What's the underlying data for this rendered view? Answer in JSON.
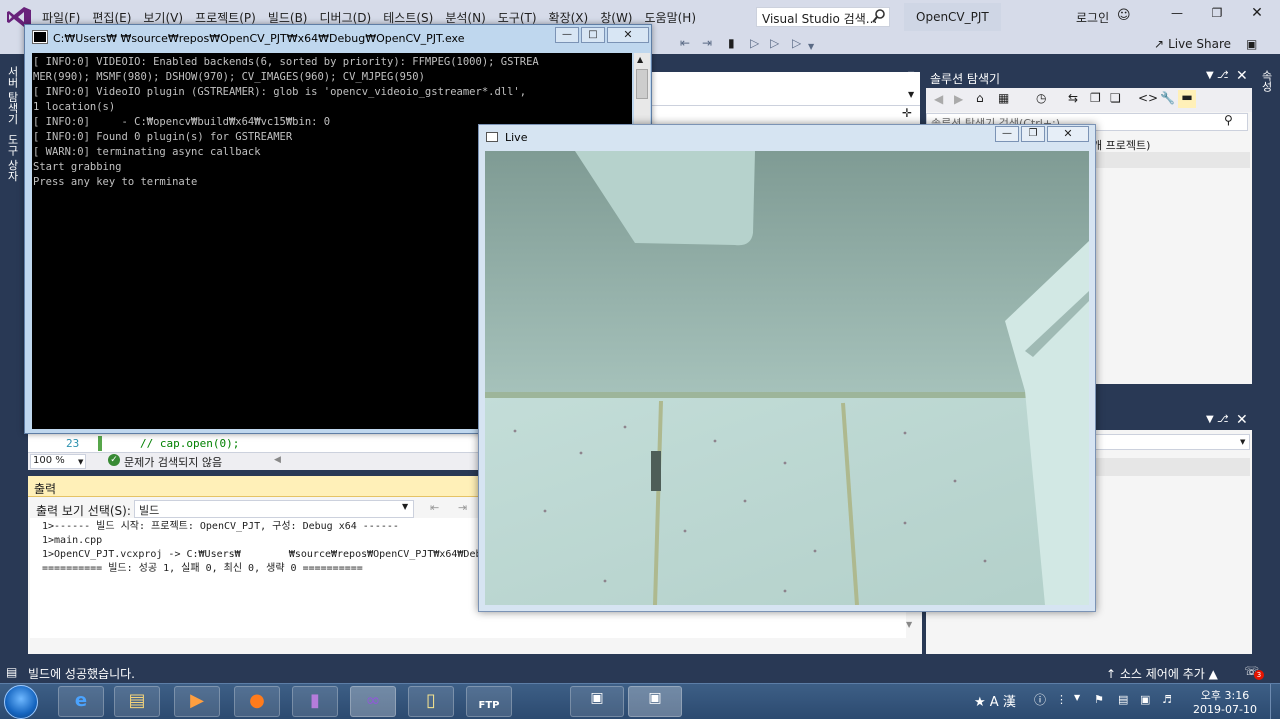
{
  "vs": {
    "menu": [
      "파일(F)",
      "편집(E)",
      "보기(V)",
      "프로젝트(P)",
      "빌드(B)",
      "디버그(D)",
      "테스트(S)",
      "분석(N)",
      "도구(T)",
      "확장(X)",
      "창(W)",
      "도움말(H)"
    ],
    "search_placeholder": "Visual Studio 검색...",
    "project_name": "OpenCV_PJT",
    "login": "로그인",
    "live_share": "Live Share",
    "left_tabs": [
      "서버 탐색기",
      "도구 상자"
    ],
    "right_tab": "속성",
    "editor": {
      "line_number": "23",
      "line_code": "// cap.open(0);",
      "zoom": "100 %",
      "issues": "문제가 검색되지 않음"
    },
    "output": {
      "title": "출력",
      "show_label": "출력 보기 선택(S):",
      "source": "빌드",
      "lines": "1>------ 빌드 시작: 프로젝트: OpenCV_PJT, 구성: Debug x64 ------\n1>main.cpp\n1>OpenCV_PJT.vcxproj -> C:₩Users₩        ₩source₩repos₩OpenCV_PJT₩x64₩Debug₩Open\n========== 빌드: 성공 1, 실패 0, 최신 0, 생략 0 =========="
    },
    "solution_explorer": {
      "title": "솔루션 탐색기",
      "search_placeholder": "솔루션 탐색기 검색(Ctrl+;)",
      "item": "개 프로젝트)"
    },
    "status": {
      "message": "빌드에 성공했습니다.",
      "source_control": "소스 제어에 추가",
      "notifications": "3"
    }
  },
  "console": {
    "title": "C:₩Users₩        ₩source₩repos₩OpenCV_PJT₩x64₩Debug₩OpenCV_PJT.exe",
    "text": "[ INFO:0] VIDEOIO: Enabled backends(6, sorted by priority): FFMPEG(1000); GSTREA\nMER(990); MSMF(980); DSHOW(970); CV_IMAGES(960); CV_MJPEG(950)\n[ INFO:0] VideoIO plugin (GSTREAMER): glob is 'opencv_videoio_gstreamer*.dll',\n1 location(s)\n[ INFO:0]     - C:₩opencv₩build₩x64₩vc15₩bin: 0\n[ INFO:0] Found 0 plugin(s) for GSTREAMER\n[ WARN:0] terminating async callback\nStart grabbing\nPress any key to terminate"
  },
  "live": {
    "title": "Live"
  },
  "taskbar": {
    "apps": [
      "internet-explorer",
      "file-explorer",
      "media-player",
      "firefox",
      "visual-studio-purple",
      "visual-studio",
      "folder",
      "ftp",
      "window-1",
      "window-2"
    ],
    "ftp_label": "FTP",
    "ime_a": "A",
    "ime_han": "漢",
    "time": "오후 3:16",
    "date": "2019-07-10"
  },
  "colors": {
    "vs_frame": "#293955",
    "vs_menu_bg": "#d6dbe9",
    "output_header": "#fff0b8",
    "console_bg": "#000000",
    "vs_purple": "#68217a"
  }
}
